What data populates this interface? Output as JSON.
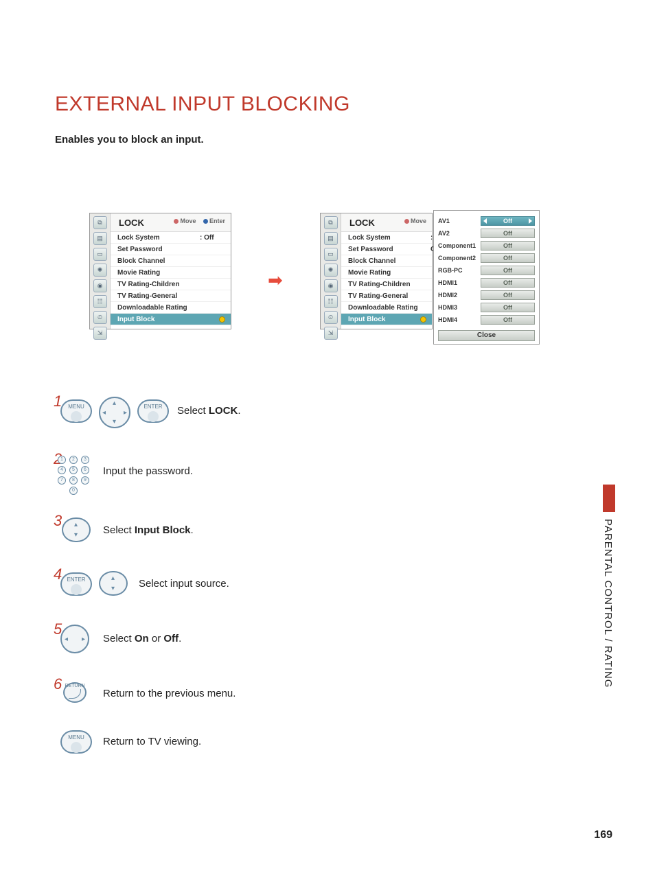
{
  "title": "EXTERNAL INPUT BLOCKING",
  "subtitle": "Enables you to block an input.",
  "side_section": "PARENTAL CONTROL / RATING",
  "page_number": "169",
  "osd_left": {
    "header": "LOCK",
    "hint_move": "Move",
    "hint_enter": "Enter",
    "items": [
      {
        "label": "Lock System",
        "value": ": Off"
      },
      {
        "label": "Set Password"
      },
      {
        "label": "Block Channel"
      },
      {
        "label": "Movie Rating"
      },
      {
        "label": "TV Rating-Children"
      },
      {
        "label": "TV Rating-General"
      },
      {
        "label": "Downloadable Rating"
      },
      {
        "label": "Input Block",
        "highlight": true
      }
    ]
  },
  "osd_right": {
    "header": "LOCK",
    "hint_move": "Move",
    "items": [
      {
        "label": "Lock System",
        "value": ": Off"
      },
      {
        "label": "Set Password"
      },
      {
        "label": "Block Channel"
      },
      {
        "label": "Movie Rating"
      },
      {
        "label": "TV Rating-Children"
      },
      {
        "label": "TV Rating-General"
      },
      {
        "label": "Downloadable Rating"
      },
      {
        "label": "Input Block",
        "highlight": true
      }
    ]
  },
  "input_block_panel": {
    "items": [
      {
        "input": "AV1",
        "value": "Off",
        "active": true
      },
      {
        "input": "AV2",
        "value": "Off"
      },
      {
        "input": "Component1",
        "value": "Off"
      },
      {
        "input": "Component2",
        "value": "Off"
      },
      {
        "input": "RGB-PC",
        "value": "Off"
      },
      {
        "input": "HDMI1",
        "value": "Off"
      },
      {
        "input": "HDMI2",
        "value": "Off"
      },
      {
        "input": "HDMI3",
        "value": "Off"
      },
      {
        "input": "HDMI4",
        "value": "Off"
      }
    ],
    "close": "Close"
  },
  "steps": {
    "s1": {
      "num": "1",
      "btn_menu": "MENU",
      "btn_enter": "ENTER",
      "text_pre": "Select ",
      "text_b": "LOCK",
      "text_post": "."
    },
    "s2": {
      "num": "2",
      "text": "Input the password."
    },
    "s3": {
      "num": "3",
      "text_pre": "Select ",
      "text_b": "Input Block",
      "text_post": "."
    },
    "s4": {
      "num": "4",
      "btn_enter": "ENTER",
      "text": "Select input source."
    },
    "s5": {
      "num": "5",
      "text_pre": "Select ",
      "text_b1": "On",
      "text_mid": " or ",
      "text_b2": "Off",
      "text_post": "."
    },
    "s6": {
      "num": "6",
      "btn_return": "RETURN",
      "text": "Return to the previous menu."
    },
    "s7": {
      "btn_menu": "MENU",
      "text": "Return to TV viewing."
    }
  }
}
